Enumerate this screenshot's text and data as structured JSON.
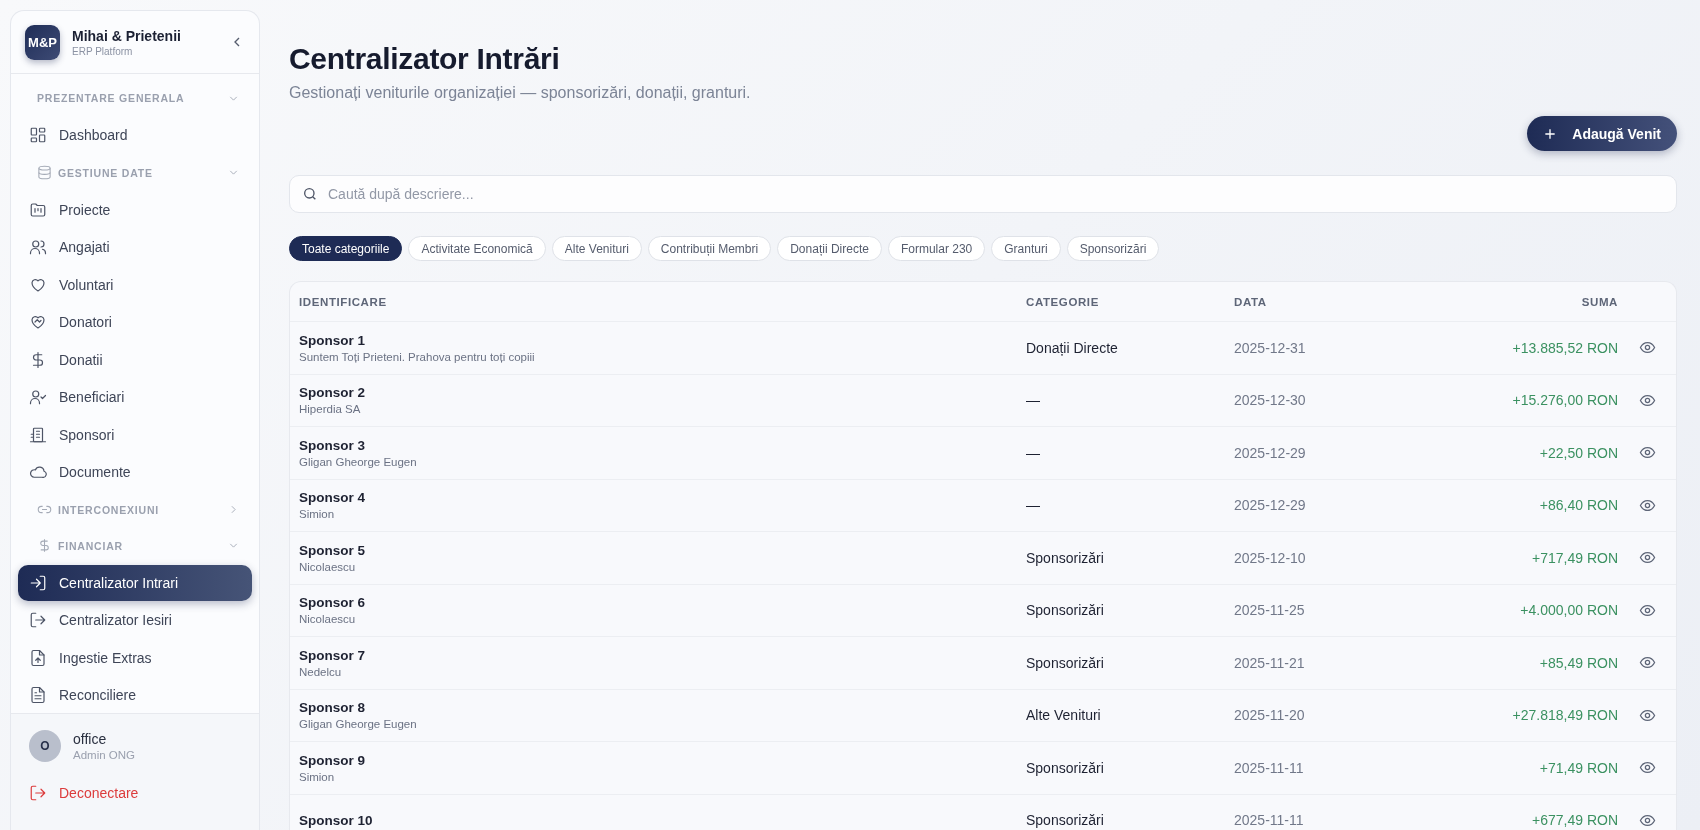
{
  "sidebar": {
    "brand": {
      "logo": "M&P",
      "name": "Mihai & Prietenii",
      "subtitle": "ERP Platform"
    },
    "sections": [
      {
        "label": "PREZENTARE GENERALA",
        "expanded": true,
        "items": [
          {
            "label": "Dashboard",
            "selected": false
          }
        ]
      },
      {
        "label": "GESTIUNE DATE",
        "expanded": true,
        "items": [
          {
            "label": "Proiecte",
            "selected": false
          },
          {
            "label": "Angajati",
            "selected": false
          },
          {
            "label": "Voluntari",
            "selected": false
          },
          {
            "label": "Donatori",
            "selected": false
          },
          {
            "label": "Donatii",
            "selected": false
          },
          {
            "label": "Beneficiari",
            "selected": false
          },
          {
            "label": "Sponsori",
            "selected": false
          },
          {
            "label": "Documente",
            "selected": false
          }
        ]
      },
      {
        "label": "INTERCONEXIUNI",
        "expanded": false
      },
      {
        "label": "FINANCIAR",
        "expanded": true,
        "items": [
          {
            "label": "Centralizator Intrari",
            "selected": true
          },
          {
            "label": "Centralizator Iesiri",
            "selected": false
          },
          {
            "label": "Ingestie Extras",
            "selected": false
          },
          {
            "label": "Reconciliere",
            "selected": false
          }
        ]
      }
    ],
    "user": {
      "initial": "O",
      "name": "office",
      "role": "Admin ONG"
    },
    "logout": "Deconectare"
  },
  "page": {
    "title": "Centralizator Intrări",
    "subtitle": "Gestionați veniturile organizației — sponsorizări, donații, granturi.",
    "add_button": "Adaugă Venit"
  },
  "search": {
    "placeholder": "Caută după descriere..."
  },
  "filters": [
    {
      "label": "Toate categoriile",
      "selected": true
    },
    {
      "label": "Activitate Economică",
      "selected": false
    },
    {
      "label": "Alte Venituri",
      "selected": false
    },
    {
      "label": "Contribuții Membri",
      "selected": false
    },
    {
      "label": "Donații Directe",
      "selected": false
    },
    {
      "label": "Formular 230",
      "selected": false
    },
    {
      "label": "Granturi",
      "selected": false
    },
    {
      "label": "Sponsorizări",
      "selected": false
    }
  ],
  "table": {
    "columns": [
      "IDENTIFICARE",
      "CATEGORIE",
      "DATA",
      "SUMA"
    ],
    "rows": [
      {
        "title": "Sponsor 1",
        "subtitle": "Suntem Toți Prieteni. Prahova pentru toți copiii",
        "category": "Donații Directe",
        "date": "2025-12-31",
        "amount": "+13.885,52 RON"
      },
      {
        "title": "Sponsor 2",
        "subtitle": "Hiperdia SA",
        "category": "—",
        "date": "2025-12-30",
        "amount": "+15.276,00 RON"
      },
      {
        "title": "Sponsor 3",
        "subtitle": "Gligan Gheorge Eugen",
        "category": "—",
        "date": "2025-12-29",
        "amount": "+22,50 RON"
      },
      {
        "title": "Sponsor 4",
        "subtitle": "Simion",
        "category": "—",
        "date": "2025-12-29",
        "amount": "+86,40 RON"
      },
      {
        "title": "Sponsor 5",
        "subtitle": "Nicolaescu",
        "category": "Sponsorizări",
        "date": "2025-12-10",
        "amount": "+717,49 RON"
      },
      {
        "title": "Sponsor 6",
        "subtitle": "Nicolaescu",
        "category": "Sponsorizări",
        "date": "2025-11-25",
        "amount": "+4.000,00 RON"
      },
      {
        "title": "Sponsor 7",
        "subtitle": "Nedelcu",
        "category": "Sponsorizări",
        "date": "2025-11-21",
        "amount": "+85,49 RON"
      },
      {
        "title": "Sponsor 8",
        "subtitle": "Gligan Gheorge Eugen",
        "category": "Alte Venituri",
        "date": "2025-11-20",
        "amount": "+27.818,49 RON"
      },
      {
        "title": "Sponsor 9",
        "subtitle": "Simion",
        "category": "Sponsorizări",
        "date": "2025-11-11",
        "amount": "+71,49 RON"
      },
      {
        "title": "Sponsor 10",
        "category": "Sponsorizări",
        "date": "2025-11-11",
        "amount": "+677,49 RON"
      }
    ]
  }
}
